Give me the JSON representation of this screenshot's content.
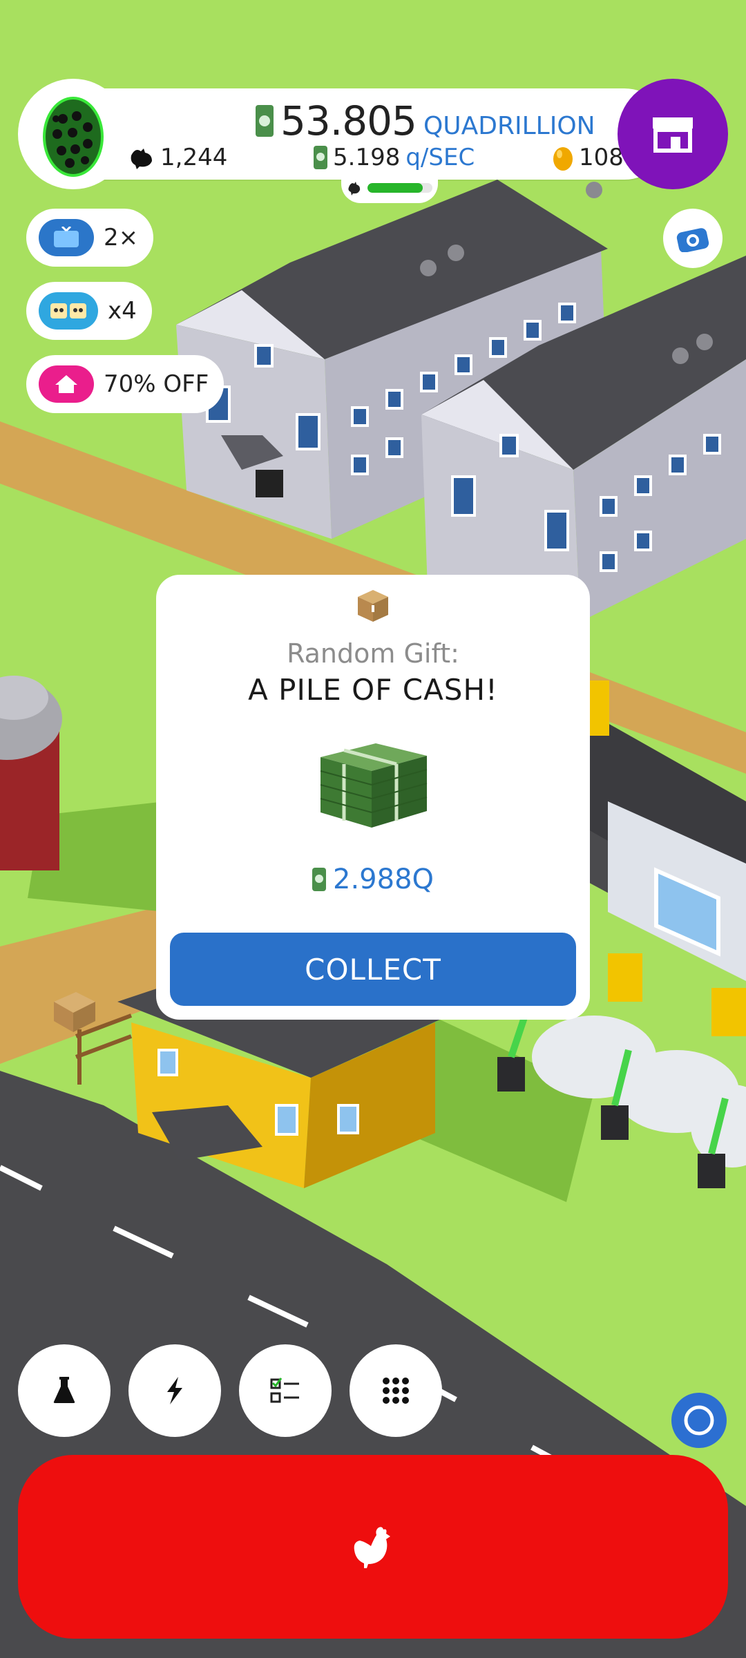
{
  "hud": {
    "money_value": "53.805",
    "money_unit": "QUADRILLION",
    "chicken_count": "1,244",
    "rate_value": "5.198",
    "rate_unit": "q/SEC",
    "golden_eggs": "108",
    "hatch_progress": 0.85
  },
  "boosts": [
    {
      "icon": "tv-ad-icon",
      "label": "2×",
      "color": "#2b76c9"
    },
    {
      "icon": "friends-icon",
      "label": "x4",
      "color": "#2fa7e0"
    },
    {
      "icon": "house-sale-icon",
      "label": "70% OFF",
      "color": "#ea1e8c"
    }
  ],
  "gift_modal": {
    "subtitle": "Random Gift:",
    "title": "A PILE OF CASH!",
    "amount": "2.988Q",
    "collect_label": "COLLECT"
  },
  "toolbar": {
    "items": [
      "research-flask-icon",
      "boost-lightning-icon",
      "missions-checklist-icon",
      "menu-grid-icon"
    ]
  },
  "colors": {
    "grass": "#a8e05f",
    "shop": "#7f13b9",
    "hatch": "#ee0e0e",
    "collect": "#2a71c9",
    "accent_text": "#2c78d0"
  }
}
